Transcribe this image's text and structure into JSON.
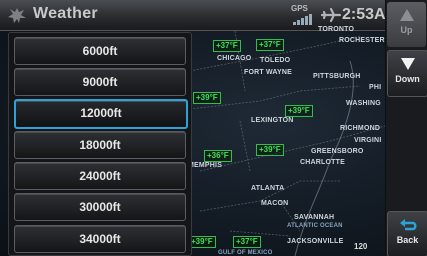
{
  "header": {
    "title": "Weather",
    "gps_label": "GPS",
    "time": "2:53",
    "time_suffix": "A"
  },
  "map": {
    "cities": [
      "TORONTO",
      "ROCHESTER",
      "CHICAGO",
      "TOLEDO",
      "FORT WAYNE",
      "PITTSBURGH",
      "PHI",
      "WASHING",
      "LEXINGTON",
      "RICHMOND",
      "VIRGINI",
      "MEMPHIS",
      "GREENSBORO",
      "CHARLOTTE",
      "ATLANTA",
      "MACON",
      "SAVANNAH",
      "ATLANTIC OCEAN",
      "JACKSONVILLE",
      "GULF OF MEXICO"
    ],
    "temps": [
      "+37°F",
      "+37°F",
      "+39°F",
      "+39°F",
      "+39°F",
      "+36°F",
      "+39°F",
      "+37°F"
    ],
    "scale": "120"
  },
  "altitude_list": {
    "options": [
      "6000ft",
      "9000ft",
      "12000ft",
      "18000ft",
      "24000ft",
      "30000ft",
      "34000ft"
    ],
    "selected": "12000ft"
  },
  "side_buttons": {
    "up": "Up",
    "down": "Down",
    "back": "Back"
  },
  "colors": {
    "selection": "#2aa3d8",
    "temp_text": "#3fe05a"
  }
}
